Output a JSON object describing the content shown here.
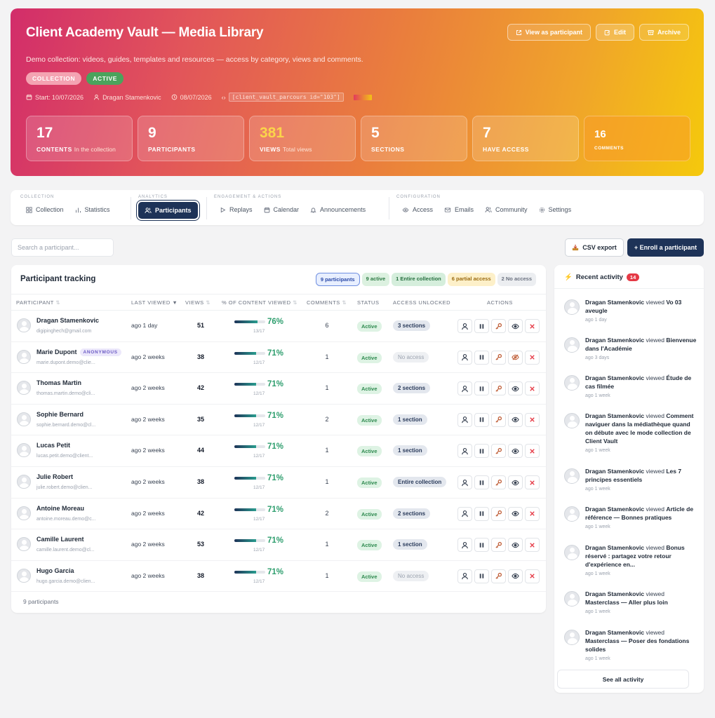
{
  "hero": {
    "title": "Client Academy Vault — Media Library",
    "description": "Demo collection: videos, guides, templates and resources — access by category, views and comments.",
    "badge_collection": "COLLECTION",
    "badge_active": "ACTIVE",
    "start": "Start: 10/07/2026",
    "author": "Dragan Stamenkovic",
    "date": "08/07/2026",
    "shortcode": "[client_vault_parcours id=\"103\"]",
    "btn_view": "View as participant",
    "btn_edit": "Edit",
    "btn_archive": "Archive",
    "stats": [
      {
        "num": "17",
        "label": "CONTENTS",
        "sub": "In the collection"
      },
      {
        "num": "9",
        "label": "PARTICIPANTS",
        "sub": ""
      },
      {
        "num": "381",
        "label": "VIEWS",
        "sub": "Total views"
      },
      {
        "num": "5",
        "label": "SECTIONS",
        "sub": ""
      },
      {
        "num": "7",
        "label": "HAVE ACCESS",
        "sub": ""
      },
      {
        "num": "16",
        "label": "COMMENTS",
        "sub": ""
      }
    ]
  },
  "nav": {
    "groups": [
      {
        "label": "COLLECTION",
        "items": [
          "Collection",
          "Statistics"
        ]
      },
      {
        "label": "ANALYTICS",
        "items": [
          "Participants"
        ]
      },
      {
        "label": "ENGAGEMENT & ACTIONS",
        "items": [
          "Replays",
          "Calendar",
          "Announcements"
        ]
      },
      {
        "label": "CONFIGURATION",
        "items": [
          "Access",
          "Emails",
          "Community",
          "Settings"
        ]
      }
    ]
  },
  "toolbar": {
    "search_placeholder": "Search a participant...",
    "csv": "CSV export",
    "enroll": "+ Enroll a participant"
  },
  "table": {
    "title": "Participant tracking",
    "filters": [
      "9 participants",
      "9 active",
      "1 Entire collection",
      "6 partial access",
      "2 No access"
    ],
    "headers": {
      "participant": "PARTICIPANT",
      "last_viewed": "LAST VIEWED",
      "views": "VIEWS",
      "pct": "% OF CONTENT VIEWED",
      "comments": "COMMENTS",
      "status": "STATUS",
      "access": "ACCESS UNLOCKED",
      "actions": "ACTIONS"
    },
    "anonymous_label": "ANONYMOUS",
    "rows": [
      {
        "name": "Dragan Stamenkovic",
        "email": "digipinghech@gmail.com",
        "last": "ago 1 day",
        "views": "51",
        "pct": "76%",
        "pct_value": 76,
        "frac": "13/17",
        "comments": "6",
        "status": "Active",
        "access": "3 sections",
        "anon": false,
        "no_access": false
      },
      {
        "name": "Marie Dupont",
        "email": "marie.dupont.demo@clie...",
        "last": "ago 2 weeks",
        "views": "38",
        "pct": "71%",
        "pct_value": 71,
        "frac": "12/17",
        "comments": "1",
        "status": "Active",
        "access": "No access",
        "anon": true,
        "no_access": true
      },
      {
        "name": "Thomas Martin",
        "email": "thomas.martin.demo@cli...",
        "last": "ago 2 weeks",
        "views": "42",
        "pct": "71%",
        "pct_value": 71,
        "frac": "12/17",
        "comments": "1",
        "status": "Active",
        "access": "2 sections",
        "anon": false,
        "no_access": false
      },
      {
        "name": "Sophie Bernard",
        "email": "sophie.bernard.demo@cl...",
        "last": "ago 2 weeks",
        "views": "35",
        "pct": "71%",
        "pct_value": 71,
        "frac": "12/17",
        "comments": "2",
        "status": "Active",
        "access": "1 section",
        "anon": false,
        "no_access": false
      },
      {
        "name": "Lucas Petit",
        "email": "lucas.petit.demo@client...",
        "last": "ago 2 weeks",
        "views": "44",
        "pct": "71%",
        "pct_value": 71,
        "frac": "12/17",
        "comments": "1",
        "status": "Active",
        "access": "1 section",
        "anon": false,
        "no_access": false
      },
      {
        "name": "Julie Robert",
        "email": "julie.robert.demo@clien...",
        "last": "ago 2 weeks",
        "views": "38",
        "pct": "71%",
        "pct_value": 71,
        "frac": "12/17",
        "comments": "1",
        "status": "Active",
        "access": "Entire collection",
        "anon": false,
        "no_access": false
      },
      {
        "name": "Antoine Moreau",
        "email": "antoine.moreau.demo@c...",
        "last": "ago 2 weeks",
        "views": "42",
        "pct": "71%",
        "pct_value": 71,
        "frac": "12/17",
        "comments": "2",
        "status": "Active",
        "access": "2 sections",
        "anon": false,
        "no_access": false
      },
      {
        "name": "Camille Laurent",
        "email": "camille.laurent.demo@cl...",
        "last": "ago 2 weeks",
        "views": "53",
        "pct": "71%",
        "pct_value": 71,
        "frac": "12/17",
        "comments": "1",
        "status": "Active",
        "access": "1 section",
        "anon": false,
        "no_access": false
      },
      {
        "name": "Hugo Garcia",
        "email": "hugo.garcia.demo@clien...",
        "last": "ago 2 weeks",
        "views": "38",
        "pct": "71%",
        "pct_value": 71,
        "frac": "12/17",
        "comments": "1",
        "status": "Active",
        "access": "No access",
        "anon": false,
        "no_access": true
      }
    ],
    "footer": "9 participants"
  },
  "activity": {
    "title": "Recent activity",
    "count": "14",
    "verb": "viewed",
    "items": [
      {
        "user": "Dragan Stamenkovic",
        "title": "Vo 03 aveugle",
        "ago": "ago 1 day"
      },
      {
        "user": "Dragan Stamenkovic",
        "title": "Bienvenue dans l'Académie",
        "ago": "ago 3 days"
      },
      {
        "user": "Dragan Stamenkovic",
        "title": "Étude de cas filmée",
        "ago": "ago 1 week"
      },
      {
        "user": "Dragan Stamenkovic",
        "title": "Comment naviguer dans la médiathèque quand on débute avec le mode collection de Client Vault",
        "ago": "ago 1 week"
      },
      {
        "user": "Dragan Stamenkovic",
        "title": "Les 7 principes essentiels",
        "ago": "ago 1 week"
      },
      {
        "user": "Dragan Stamenkovic",
        "title": "Article de référence — Bonnes pratiques",
        "ago": "ago 1 week"
      },
      {
        "user": "Dragan Stamenkovic",
        "title": "Bonus réservé : partagez votre retour d'expérience en...",
        "ago": "ago 1 week"
      },
      {
        "user": "Dragan Stamenkovic",
        "title": "Masterclass — Aller plus loin",
        "ago": "ago 1 week"
      },
      {
        "user": "Dragan Stamenkovic",
        "title": "Masterclass — Poser des fondations solides",
        "ago": "ago 1 week"
      }
    ],
    "see_all": "See all activity"
  }
}
